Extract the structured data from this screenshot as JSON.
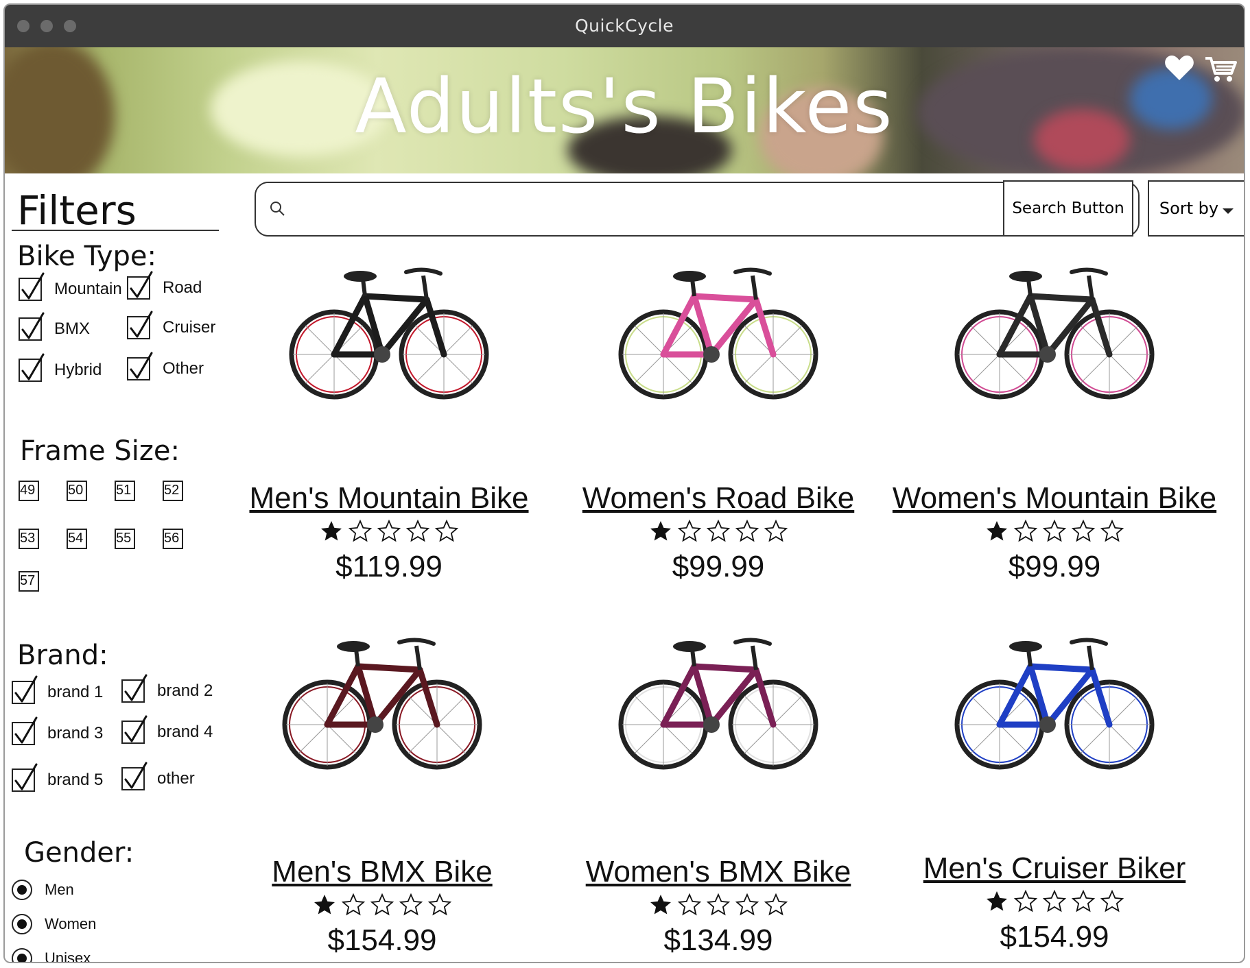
{
  "window": {
    "title": "QuickCycle"
  },
  "hero": {
    "title": "Adults's Bikes"
  },
  "header_icons": [
    "heart-icon",
    "cart-icon"
  ],
  "filters": {
    "title": "Filters",
    "bike_type": {
      "label": "Bike Type:",
      "options": [
        {
          "label": "Mountain",
          "checked": true
        },
        {
          "label": "Road",
          "checked": true
        },
        {
          "label": "BMX",
          "checked": true
        },
        {
          "label": "Cruiser",
          "checked": true
        },
        {
          "label": "Hybrid",
          "checked": true
        },
        {
          "label": "Other",
          "checked": true
        }
      ]
    },
    "frame_size": {
      "label": "Frame Size:",
      "sizes": [
        "49",
        "50",
        "51",
        "52",
        "53",
        "54",
        "55",
        "56",
        "57"
      ]
    },
    "brand": {
      "label": "Brand:",
      "options": [
        {
          "label": "brand 1",
          "checked": true
        },
        {
          "label": "brand 2",
          "checked": true
        },
        {
          "label": "brand 3",
          "checked": true
        },
        {
          "label": "brand 4",
          "checked": true
        },
        {
          "label": "brand 5",
          "checked": true
        },
        {
          "label": "other",
          "checked": true
        }
      ]
    },
    "gender": {
      "label": "Gender:",
      "options": [
        "Men",
        "Women",
        "Unisex"
      ]
    }
  },
  "search": {
    "placeholder": "",
    "button_label": "Search Button"
  },
  "sort": {
    "label": "Sort by"
  },
  "products": [
    {
      "name": "Men's Mountain Bike",
      "rating": 1,
      "max_rating": 5,
      "price": "$119.99",
      "frame_color": "#1c1c1c",
      "accent": "#c2182b"
    },
    {
      "name": "Women's Road Bike",
      "rating": 1,
      "max_rating": 5,
      "price": "$99.99",
      "frame_color": "#d94f9a",
      "accent": "#c9dd8a"
    },
    {
      "name": "Women's Mountain Bike",
      "rating": 1,
      "max_rating": 5,
      "price": "$99.99",
      "frame_color": "#2a2a2a",
      "accent": "#d04a92"
    },
    {
      "name": "Men's BMX Bike",
      "rating": 1,
      "max_rating": 5,
      "price": "$154.99",
      "frame_color": "#5a1820",
      "accent": "#8a1a25"
    },
    {
      "name": "Women's BMX Bike",
      "rating": 1,
      "max_rating": 5,
      "price": "$134.99",
      "frame_color": "#7a2055",
      "accent": "#e0e0e0"
    },
    {
      "name": "Men's Cruiser Biker",
      "rating": 1,
      "max_rating": 5,
      "price": "$154.99",
      "frame_color": "#1f3fc4",
      "accent": "#1f3fc4"
    }
  ]
}
